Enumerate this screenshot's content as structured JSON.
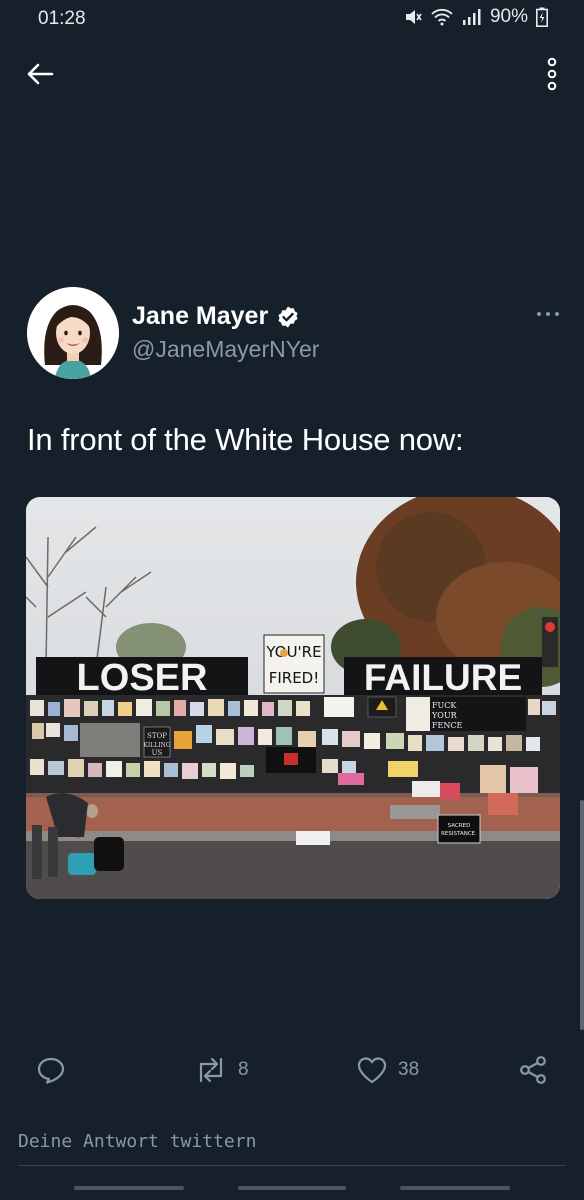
{
  "status_bar": {
    "time": "01:28",
    "battery": "90%"
  },
  "tweet": {
    "author_name": "Jane Mayer",
    "author_handle": "@JaneMayerNYer",
    "verified": true,
    "text": "In front of the White House now:",
    "photo_signs": {
      "loser": "LOSER",
      "failure": "FAILURE",
      "youre": "YOU'RE",
      "fired": "FIRED!",
      "stop": "STOP",
      "killing": "KILLING",
      "us": "US",
      "fuck": "FUCK",
      "your": "YOUR",
      "fence": "FENCE",
      "sacred": "SACRED",
      "resistance": "RESISTANCE."
    }
  },
  "actions": {
    "retweet_count": "8",
    "like_count": "38"
  },
  "composer": {
    "placeholder": "Deine Antwort twittern"
  },
  "colors": {
    "background": "#15202b",
    "secondary_text": "#8b98a5",
    "divider": "#38444d"
  }
}
